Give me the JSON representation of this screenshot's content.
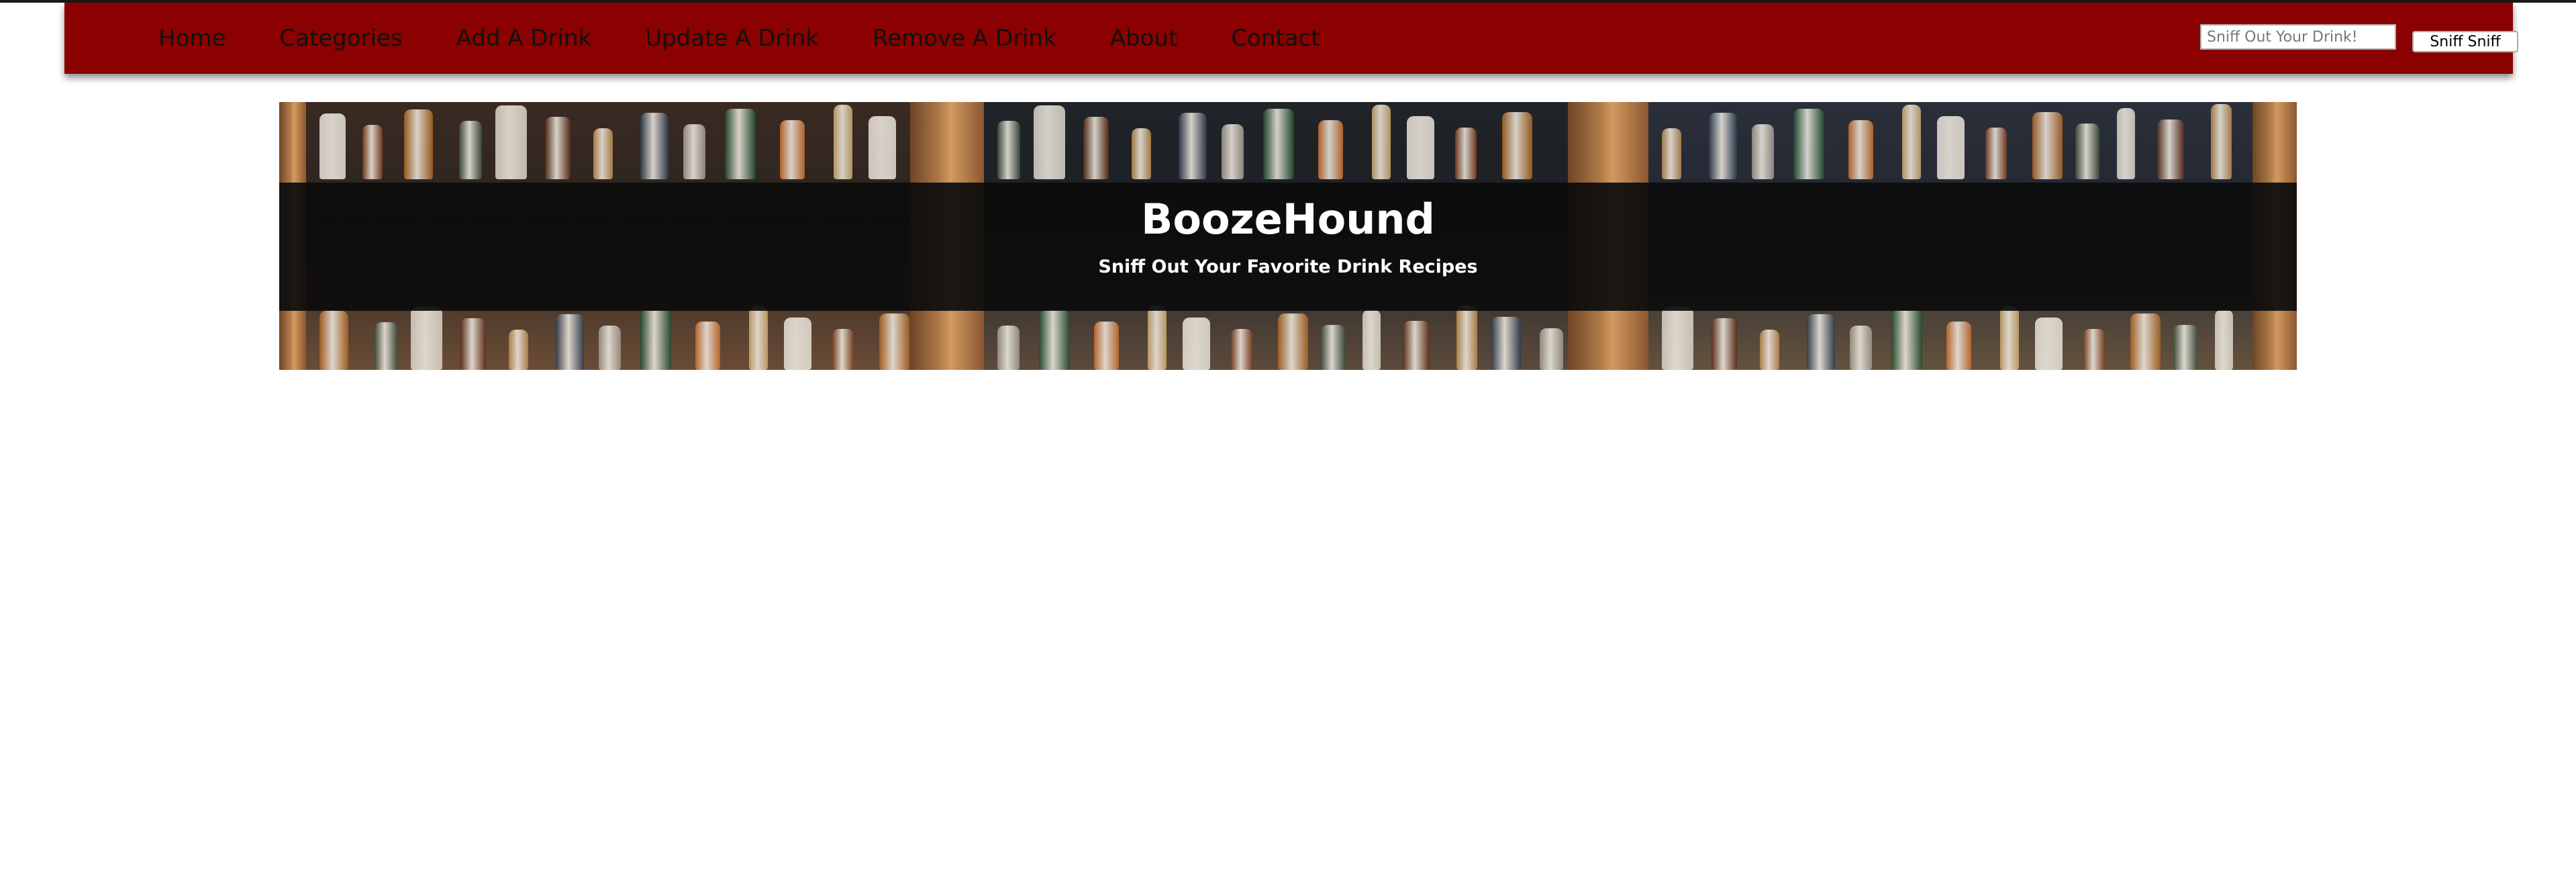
{
  "nav": {
    "links": [
      {
        "label": "Home"
      },
      {
        "label": "Categories"
      },
      {
        "label": "Add A Drink"
      },
      {
        "label": "Update A Drink"
      },
      {
        "label": "Remove A Drink"
      },
      {
        "label": "About"
      },
      {
        "label": "Contact"
      }
    ],
    "search": {
      "placeholder": "Sniff Out Your Drink!",
      "value": "",
      "button_label": "Sniff Sniff"
    }
  },
  "hero": {
    "title": "BoozeHound",
    "subtitle": "Sniff Out Your Favorite Drink Recipes"
  },
  "colors": {
    "navbar": "#8b0000",
    "nav_text": "#111111",
    "hero_overlay": "#0c0c0c",
    "hero_text": "#ffffff"
  }
}
